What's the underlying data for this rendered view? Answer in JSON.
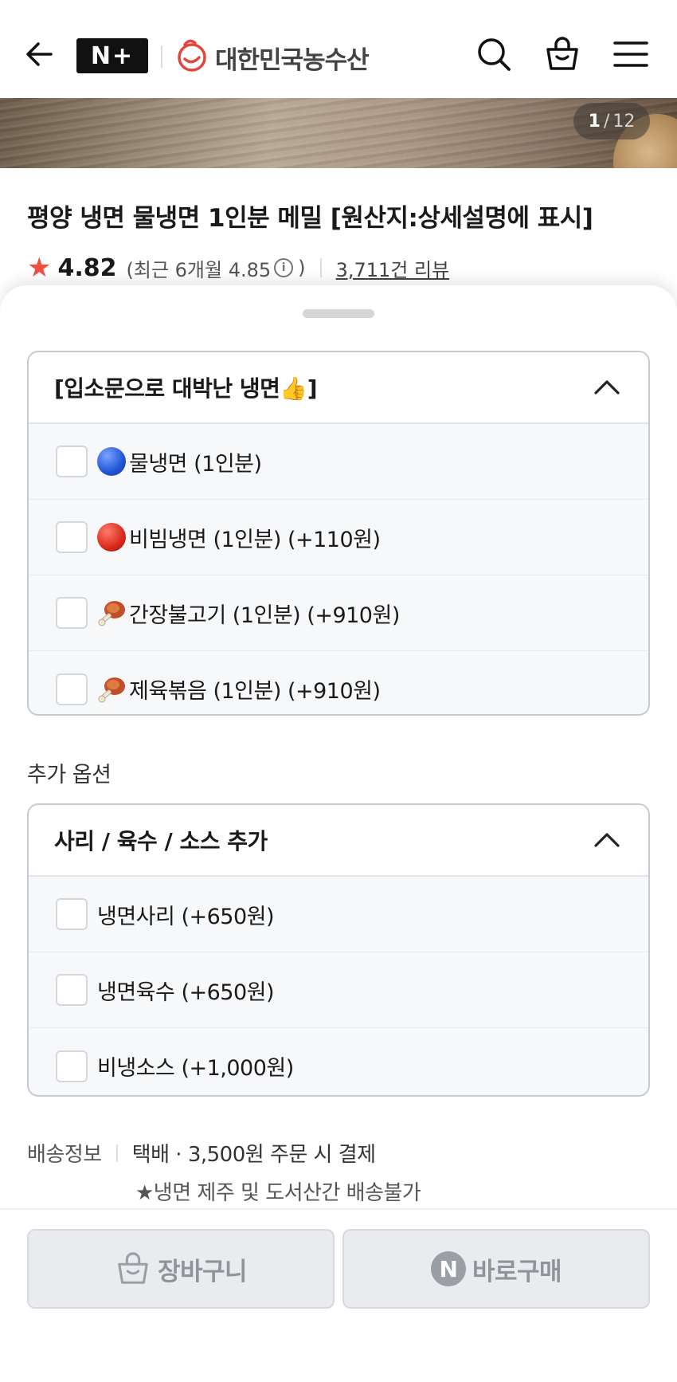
{
  "header": {
    "nplus_logo": "N+",
    "brand_name": "대한민국농수산",
    "icons": [
      "back-arrow-icon",
      "search-icon",
      "shopping-bag-icon",
      "menu-icon"
    ]
  },
  "gallery": {
    "current": "1",
    "divider": "/",
    "total": "12"
  },
  "product": {
    "title": "평양 냉면 물냉면 1인분 메밀 [원산지:상세설명에 표시]",
    "rating": "4.82",
    "recent_rating_text": "(최근 6개월 4.85",
    "recent_rating_close": ")",
    "info_glyph": "i",
    "review_count": "3,711건 리뷰"
  },
  "option_group_main": {
    "title": "[입소문으로 대박난 냉면👍]",
    "options": [
      {
        "icon": "blue-circle",
        "label": "물냉면 (1인분)"
      },
      {
        "icon": "red-circle",
        "label": "비빔냉면 (1인분) (+110원)"
      },
      {
        "icon": "meat-on-bone",
        "label": "간장불고기 (1인분) (+910원)"
      },
      {
        "icon": "meat-on-bone",
        "label": "제육볶음 (1인분) (+910원)"
      }
    ]
  },
  "extra_section_label": "추가 옵션",
  "option_group_extra": {
    "title": "사리 / 육수 / 소스 추가",
    "options": [
      {
        "label": "냉면사리 (+650원)"
      },
      {
        "label": "냉면육수 (+650원)"
      },
      {
        "label": "비냉소스 (+1,000원)"
      }
    ]
  },
  "shipping": {
    "label": "배송정보",
    "value": "택배 · 3,500원 주문 시 결제",
    "note": "★냉면 제주 및 도서산간 배송불가"
  },
  "footer": {
    "cart_label": "장바구니",
    "buy_label": "바로구매",
    "buy_badge": "N"
  },
  "colors": {
    "star": "#f04f3e",
    "brand_red": "#e0463a",
    "disabled_button": "#e9ebee"
  }
}
